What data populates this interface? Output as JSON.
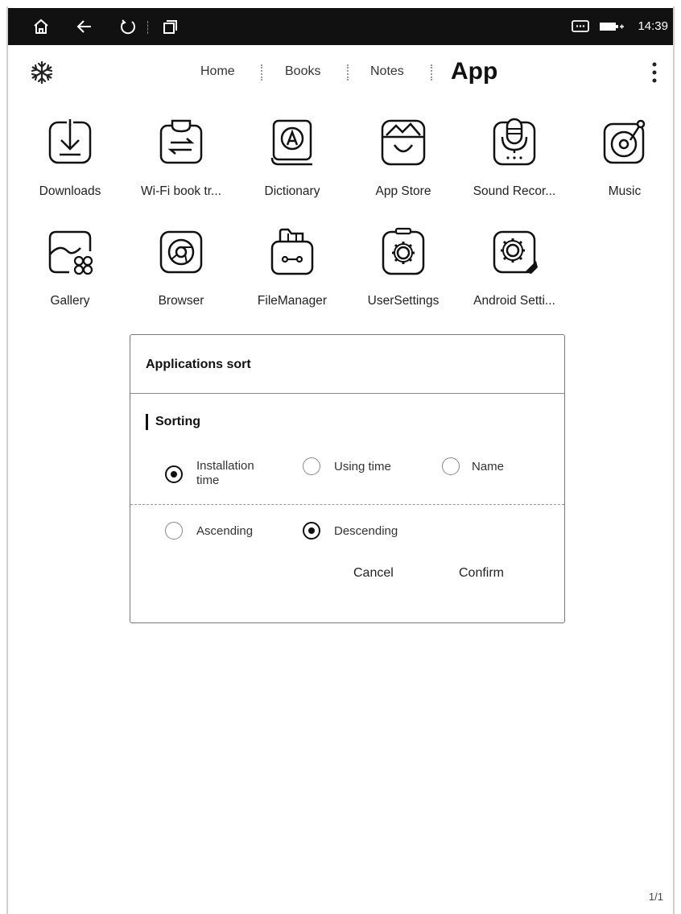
{
  "status_bar": {
    "time": "14:39",
    "icons": [
      "home-icon",
      "back-icon",
      "refresh-icon",
      "recent-apps-icon",
      "chat-icon",
      "battery-icon"
    ]
  },
  "header": {
    "nav": [
      "Home",
      "Books",
      "Notes"
    ],
    "active": "App",
    "left_icon": "snowflake-icon",
    "right_icon": "more-vertical-icon"
  },
  "apps": [
    {
      "label": "Downloads",
      "icon": "download-icon"
    },
    {
      "label": "Wi-Fi book tr...",
      "icon": "wifi-transfer-icon"
    },
    {
      "label": "Dictionary",
      "icon": "dictionary-icon"
    },
    {
      "label": "App Store",
      "icon": "app-store-icon"
    },
    {
      "label": "Sound Recor...",
      "icon": "microphone-icon"
    },
    {
      "label": "Music",
      "icon": "music-icon"
    },
    {
      "label": "Gallery",
      "icon": "gallery-icon"
    },
    {
      "label": "Browser",
      "icon": "browser-icon"
    },
    {
      "label": "FileManager",
      "icon": "file-manager-icon"
    },
    {
      "label": "UserSettings",
      "icon": "user-settings-icon"
    },
    {
      "label": "Android Setti...",
      "icon": "android-settings-icon"
    }
  ],
  "dialog": {
    "title": "Applications sort",
    "section": "Sorting",
    "sort_options": [
      {
        "label": "Installation time",
        "line1": "Installation",
        "line2": "time",
        "selected": true
      },
      {
        "label": "Using time",
        "selected": false
      },
      {
        "label": "Name",
        "selected": false
      }
    ],
    "order_options": [
      {
        "label": "Ascending",
        "selected": false
      },
      {
        "label": "Descending",
        "selected": true
      }
    ],
    "cancel": "Cancel",
    "confirm": "Confirm"
  },
  "pager": "1/1"
}
